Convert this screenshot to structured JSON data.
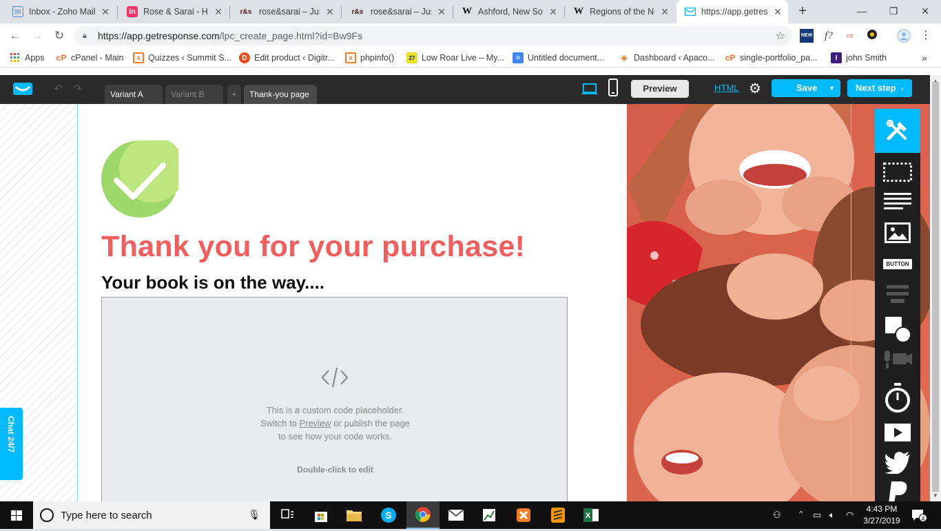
{
  "browser": {
    "tabs": [
      {
        "title": "Inbox - Zoho Mail",
        "icon": "zoho-mail-icon",
        "active": false
      },
      {
        "title": "Rose & Sarai - Home",
        "icon": "invision-icon",
        "active": false
      },
      {
        "title": "rose&sarai – Just a",
        "icon": "rs-icon",
        "active": false
      },
      {
        "title": "rose&sarai – Just a",
        "icon": "rs-icon",
        "active": false
      },
      {
        "title": "Ashford, New South",
        "icon": "wikipedia-icon",
        "active": false
      },
      {
        "title": "Regions of the No",
        "icon": "wikipedia-icon",
        "active": false
      },
      {
        "title": "https://app.getresp",
        "icon": "getresponse-icon",
        "active": true
      }
    ],
    "url_host": "https://app.getresponse.com",
    "url_path": "/lpc_create_page.html?id=Bw9Fs",
    "bookmarks": [
      {
        "label": "Apps",
        "icon": "apps-grid-icon"
      },
      {
        "label": "cPanel - Main",
        "icon": "cpanel-icon"
      },
      {
        "label": "Quizzes ‹ Summit S...",
        "icon": "xampp-icon"
      },
      {
        "label": "Edit product ‹ Digitr...",
        "icon": "d-icon"
      },
      {
        "label": "phpinfo()",
        "icon": "xampp-icon"
      },
      {
        "label": "Low Roar Live – My...",
        "icon": "calendar-27-icon"
      },
      {
        "label": "Untitled document...",
        "icon": "google-docs-icon"
      },
      {
        "label": "Dashboard ‹ Apaco...",
        "icon": "apaco-icon"
      },
      {
        "label": "single-portfolio_pa...",
        "icon": "cpanel-icon"
      },
      {
        "label": "john Smith",
        "icon": "i-icon"
      }
    ]
  },
  "editor": {
    "tabs": {
      "variant_a": "Variant A",
      "variant_b": "Variant B",
      "add": "+",
      "thank_you": "Thank-you page"
    },
    "preview_label": "Preview",
    "html_label": "HTML",
    "save_label": "Save",
    "next_label": "Next step",
    "chat_label": "Chat 24/7",
    "accent_color": "#00baff"
  },
  "page": {
    "heading": "Thank you for your purchase!",
    "subheading": "Your book is on the way....",
    "heading_color": "#f25d5d",
    "placeholder": {
      "line1": "This is a custom code placeholder.",
      "line2_before": "Switch to ",
      "line2_link": "Preview",
      "line2_after": " or publish the page",
      "line3": "to see how your code works.",
      "edit_hint": "Double-click to edit"
    }
  },
  "tools_panel": {
    "items": [
      {
        "name": "design-tools-icon"
      },
      {
        "name": "section-icon"
      },
      {
        "name": "text-icon"
      },
      {
        "name": "image-icon"
      },
      {
        "name": "button-icon",
        "label": "BUTTON"
      },
      {
        "name": "form-icon"
      },
      {
        "name": "shapes-icon"
      },
      {
        "name": "webinar-icon"
      },
      {
        "name": "countdown-timer-icon"
      },
      {
        "name": "video-icon"
      },
      {
        "name": "twitter-icon"
      },
      {
        "name": "paypal-icon"
      }
    ]
  },
  "taskbar": {
    "search_placeholder": "Type here to search",
    "time": "4:43 PM",
    "date": "3/27/2019",
    "notification_count": "4"
  }
}
